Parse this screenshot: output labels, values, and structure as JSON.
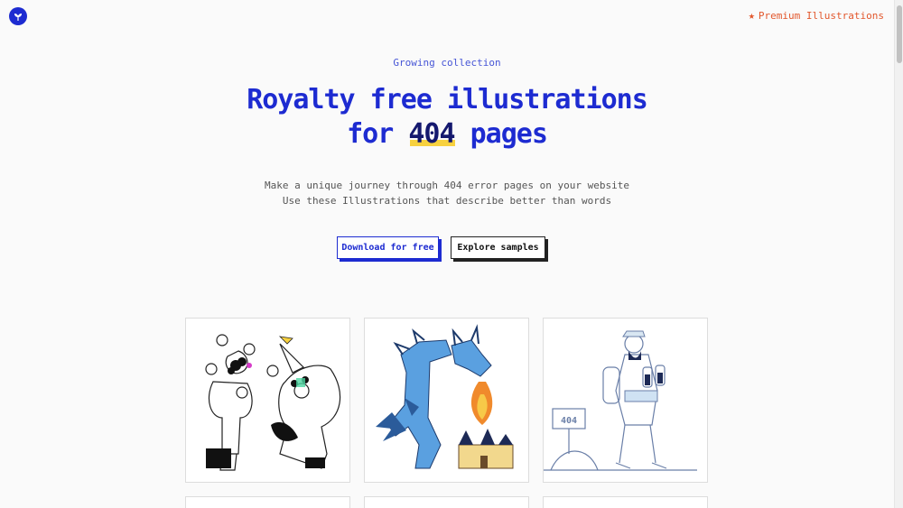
{
  "header": {
    "logo_icon": "leaf-logo-icon",
    "premium_link": "Premium Illustrations",
    "premium_icon": "star-icon"
  },
  "hero": {
    "eyebrow": "Growing collection",
    "title_line1": "Royalty free illustrations",
    "title_for": "for",
    "title_highlight": "404",
    "title_pages": "pages",
    "subtitle_line1": "Make a unique journey through 404 error pages on your website",
    "subtitle_line2": "Use these Illustrations that describe better than words",
    "download_button": "Download for free",
    "explore_button": "Explore samples"
  },
  "gallery": {
    "cards": [
      {
        "subject": "juggling-clown-illustration"
      },
      {
        "subject": "fire-breathing-dragon-illustration"
      },
      {
        "subject": "hiker-with-binoculars-illustration",
        "sign_text": "404"
      }
    ]
  },
  "colors": {
    "brand": "#1d2bd1",
    "accent": "#e2572c",
    "highlight": "#f7d13f",
    "dragon": "#5aa0e0",
    "fire": "#f08a2c"
  }
}
